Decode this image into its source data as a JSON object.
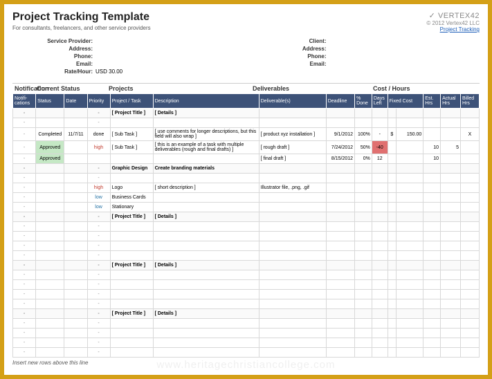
{
  "header": {
    "title": "Project Tracking Template",
    "subtitle": "For consultants, freelancers, and other service providers",
    "logo_text": "✓ VERTEX42",
    "copyright": "© 2012 Vertex42 LLC",
    "link_text": "Project Tracking"
  },
  "provider": {
    "lbl_service": "Service Provider:",
    "lbl_address": "Address:",
    "lbl_phone": "Phone:",
    "lbl_email": "Email:",
    "lbl_rate": "Rate/Hour:",
    "rate_val": "USD 30.00"
  },
  "client": {
    "lbl_client": "Client:",
    "lbl_address": "Address:",
    "lbl_phone": "Phone:",
    "lbl_email": "Email:"
  },
  "groups": {
    "notification": "Notification",
    "status": "Current Status",
    "projects": "Projects",
    "deliverables": "Deliverables",
    "cost": "Cost / Hours"
  },
  "cols": {
    "notif": "Notifi-\ncations",
    "status": "Status",
    "date": "Date",
    "priority": "Priority",
    "task": "Project / Task",
    "desc": "Description",
    "deliv": "Deliverable(s)",
    "deadline": "Deadline",
    "pct": "%\nDone",
    "days": "Days\nLeft",
    "fixed": "Fixed Cost",
    "est": "Est.\nHrs",
    "act": "Actual\nHrs",
    "bill": "Billed\nHrs"
  },
  "rows": [
    {
      "type": "section",
      "task": "[ Project Title ]",
      "desc": "[ Details ]"
    },
    {
      "type": "blank"
    },
    {
      "type": "data",
      "status": "Completed",
      "status_cls": "status-completed",
      "date": "11/7/11",
      "priority": "done",
      "pri_cls": "",
      "task": "[ Sub Task ]",
      "desc": "[ use comments for longer descriptions, but this field will also wrap ]",
      "deliv": "[ product xyz installation ]",
      "deadline": "9/1/2012",
      "pct": "100%",
      "days": "-",
      "days_cls": "",
      "fixed_pre": "$",
      "fixed": "150.00",
      "est": "",
      "act": "",
      "bill": "X"
    },
    {
      "type": "data",
      "status": "Approved",
      "status_cls": "status-approved",
      "date": "",
      "priority": "high",
      "pri_cls": "pri-high",
      "task": "[ Sub Task ]",
      "desc": "[ this is an example of a task with multiple deliverables (rough and final drafts) ]",
      "deliv": "[ rough draft ]",
      "deadline": "7/24/2012",
      "pct": "50%",
      "days": "-40",
      "days_cls": "days-neg",
      "fixed_pre": "",
      "fixed": "",
      "est": "10",
      "act": "5",
      "bill": ""
    },
    {
      "type": "data",
      "status": "Approved",
      "status_cls": "status-approved",
      "date": "",
      "priority": "",
      "pri_cls": "",
      "task": "",
      "desc": "",
      "deliv": "[ final draft ]",
      "deadline": "8/15/2012",
      "pct": "0%",
      "days": "12",
      "days_cls": "",
      "fixed_pre": "",
      "fixed": "",
      "est": "10",
      "act": "",
      "bill": ""
    },
    {
      "type": "section2",
      "task": "Graphic Design",
      "desc": "Create branding materials"
    },
    {
      "type": "blank"
    },
    {
      "type": "data",
      "status": "",
      "status_cls": "",
      "date": "",
      "priority": "high",
      "pri_cls": "pri-high",
      "task": "Logo",
      "desc": "[ short description ]",
      "deliv": "Illustrator file, .png, .gif",
      "deadline": "",
      "pct": "",
      "days": "",
      "days_cls": "",
      "fixed_pre": "",
      "fixed": "",
      "est": "",
      "act": "",
      "bill": ""
    },
    {
      "type": "data",
      "status": "",
      "status_cls": "",
      "date": "",
      "priority": "low",
      "pri_cls": "pri-low",
      "task": "Business Cards",
      "desc": "",
      "deliv": "",
      "deadline": "",
      "pct": "",
      "days": "",
      "days_cls": "",
      "fixed_pre": "",
      "fixed": "",
      "est": "",
      "act": "",
      "bill": ""
    },
    {
      "type": "data",
      "status": "",
      "status_cls": "",
      "date": "",
      "priority": "low",
      "pri_cls": "pri-low",
      "task": "Stationary",
      "desc": "",
      "deliv": "",
      "deadline": "",
      "pct": "",
      "days": "",
      "days_cls": "",
      "fixed_pre": "",
      "fixed": "",
      "est": "",
      "act": "",
      "bill": ""
    },
    {
      "type": "section",
      "task": "[ Project Title ]",
      "desc": "[ Details ]"
    },
    {
      "type": "blank"
    },
    {
      "type": "blank"
    },
    {
      "type": "blank"
    },
    {
      "type": "blank"
    },
    {
      "type": "section",
      "task": "[ Project Title ]",
      "desc": "[ Details ]"
    },
    {
      "type": "blank"
    },
    {
      "type": "blank"
    },
    {
      "type": "blank"
    },
    {
      "type": "blank"
    },
    {
      "type": "section",
      "task": "[ Project Title ]",
      "desc": "[ Details ]"
    },
    {
      "type": "blank"
    },
    {
      "type": "blank"
    },
    {
      "type": "blank"
    },
    {
      "type": "blank"
    }
  ],
  "footer": "Insert new rows above this line",
  "dash": "-"
}
